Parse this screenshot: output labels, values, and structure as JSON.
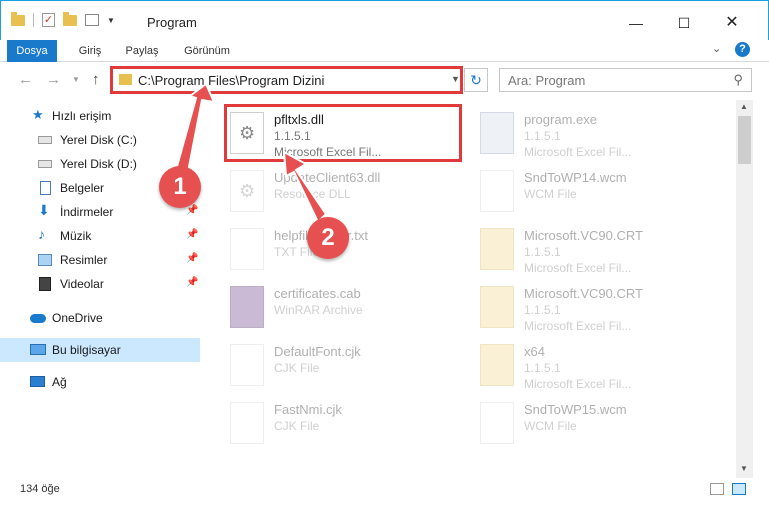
{
  "window": {
    "title": "Program",
    "controls": {
      "minimize": "—",
      "maximize": "☐",
      "close": "✕"
    }
  },
  "ribbon": {
    "tabs": [
      "Dosya",
      "Giriş",
      "Paylaş",
      "Görünüm"
    ],
    "help": "?"
  },
  "nav": {
    "address": "C:\\Program Files\\Program Dizini",
    "search_placeholder": "Ara: Program"
  },
  "sidebar": {
    "items": [
      {
        "label": "Hızlı erişim",
        "icon": "star-icon"
      },
      {
        "label": "Yerel Disk (C:)",
        "icon": "drive-icon"
      },
      {
        "label": "Yerel Disk (D:)",
        "icon": "drive-icon"
      },
      {
        "label": "Belgeler",
        "icon": "documents-icon"
      },
      {
        "label": "İndirmeler",
        "icon": "download-icon"
      },
      {
        "label": "Müzik",
        "icon": "music-icon"
      },
      {
        "label": "Resimler",
        "icon": "pictures-icon"
      },
      {
        "label": "Videolar",
        "icon": "videos-icon"
      },
      {
        "label": "OneDrive",
        "icon": "cloud-icon"
      },
      {
        "label": "Bu bilgisayar",
        "icon": "computer-icon"
      },
      {
        "label": "Ağ",
        "icon": "network-icon"
      }
    ]
  },
  "files": [
    {
      "name": "pfltxls.dll",
      "l2": "1.1.5.1",
      "l3": "Microsoft Excel Fil..."
    },
    {
      "name": "program.exe",
      "l2": "1.1.5.1",
      "l3": "Microsoft Excel Fil..."
    },
    {
      "name": "UpdateClient63.dll",
      "l2": "Resource DLL",
      "l3": ""
    },
    {
      "name": "SndToWP14.wcm",
      "l2": "WCM File",
      "l3": ""
    },
    {
      "name": "helpfileloader.txt",
      "l2": "TXT File",
      "l3": ""
    },
    {
      "name": "Microsoft.VC90.CRT",
      "l2": "1.1.5.1",
      "l3": "Microsoft Excel Fil..."
    },
    {
      "name": "certificates.cab",
      "l2": "WinRAR Archive",
      "l3": ""
    },
    {
      "name": "Microsoft.VC90.CRT",
      "l2": "1.1.5.1",
      "l3": "Microsoft Excel Fil..."
    },
    {
      "name": "DefaultFont.cjk",
      "l2": "CJK File",
      "l3": ""
    },
    {
      "name": "x64",
      "l2": "1.1.5.1",
      "l3": "Microsoft Excel Fil..."
    },
    {
      "name": "FastNmi.cjk",
      "l2": "CJK File",
      "l3": ""
    },
    {
      "name": "SndToWP15.wcm",
      "l2": "WCM File",
      "l3": ""
    }
  ],
  "status": {
    "count": "134 öğe"
  },
  "annotations": {
    "badge1": "1",
    "badge2": "2",
    "color": "#e65050"
  }
}
